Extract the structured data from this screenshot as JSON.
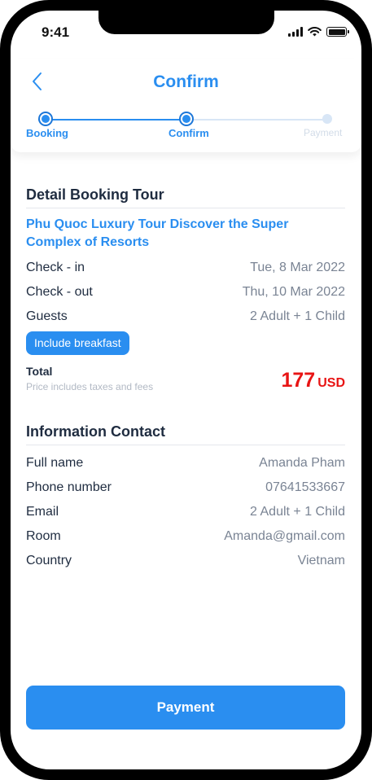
{
  "status_bar": {
    "time": "9:41"
  },
  "header": {
    "title": "Confirm"
  },
  "steps": [
    {
      "label": "Booking",
      "state": "done"
    },
    {
      "label": "Confirm",
      "state": "active"
    },
    {
      "label": "Payment",
      "state": "pending"
    }
  ],
  "booking": {
    "section_title": "Detail Booking Tour",
    "tour_name": "Phu Quoc Luxury Tour Discover the Super Complex of Resorts",
    "rows": [
      {
        "label": "Check - in",
        "value": "Tue, 8 Mar 2022"
      },
      {
        "label": "Check - out",
        "value": "Thu, 10 Mar 2022"
      },
      {
        "label": "Guests",
        "value": "2 Adult + 1 Child"
      }
    ],
    "badge": "Include breakfast",
    "total_label": "Total",
    "total_note": "Price includes taxes and fees",
    "price_amount": "177",
    "price_currency": "USD"
  },
  "contact": {
    "section_title": "Information Contact",
    "rows": [
      {
        "label": "Full name",
        "value": "Amanda Pham"
      },
      {
        "label": "Phone number",
        "value": "07641533667"
      },
      {
        "label": "Email",
        "value": "2 Adult + 1 Child"
      },
      {
        "label": "Room",
        "value": "Amanda@gmail.com"
      },
      {
        "label": "Country",
        "value": "Vietnam"
      }
    ]
  },
  "footer": {
    "payment_button": "Payment"
  },
  "colors": {
    "accent": "#2a8ef0",
    "price": "#e81414",
    "heading": "#1f2c40",
    "muted": "#7a8494"
  }
}
